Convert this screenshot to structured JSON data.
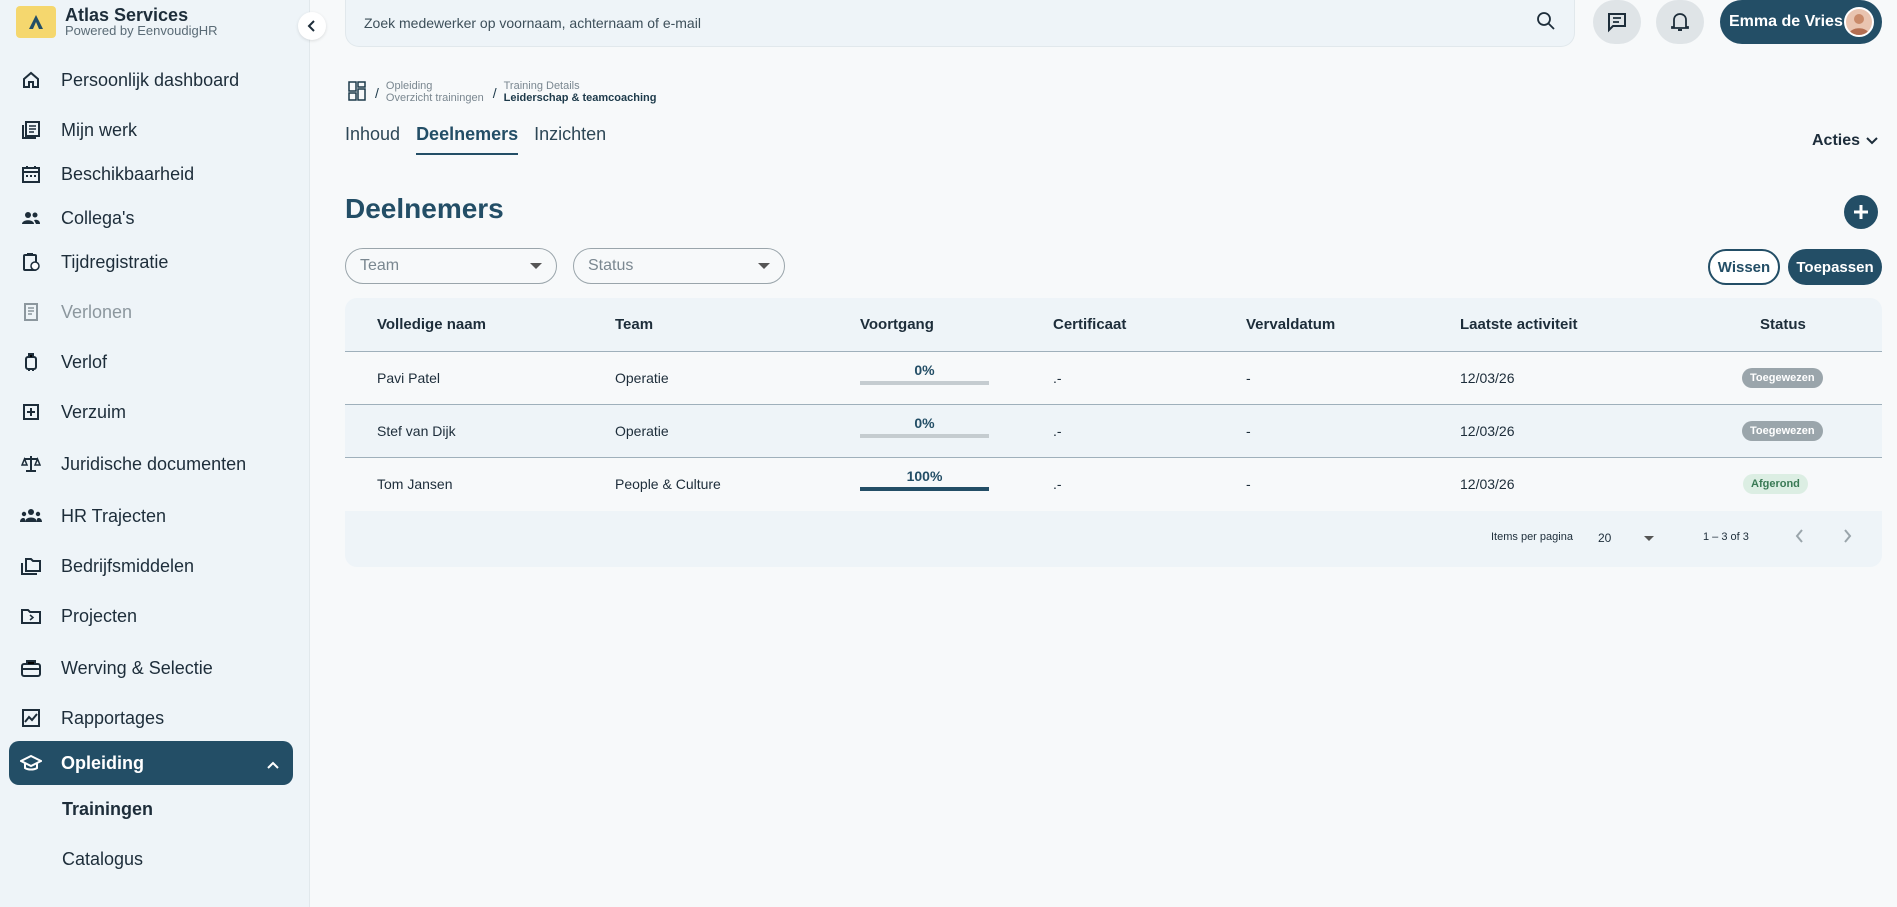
{
  "brand": {
    "title": "Atlas Services",
    "subtitle": "Powered by EenvoudigHR"
  },
  "sidebar": {
    "items": [
      {
        "label": "Persoonlijk dashboard",
        "icon": "home-icon"
      },
      {
        "label": "Mijn werk",
        "icon": "document-list-icon"
      },
      {
        "label": "Beschikbaarheid",
        "icon": "calendar-icon"
      },
      {
        "label": "Collega's",
        "icon": "people-icon"
      },
      {
        "label": "Tijdregistratie",
        "icon": "clipboard-clock-icon"
      },
      {
        "label": "Verlonen",
        "icon": "receipt-icon"
      },
      {
        "label": "Verlof",
        "icon": "suitcase-icon"
      },
      {
        "label": "Verzuim",
        "icon": "medical-icon"
      },
      {
        "label": "Juridische documenten",
        "icon": "scale-icon"
      },
      {
        "label": "HR Trajecten",
        "icon": "group-icon"
      },
      {
        "label": "Bedrijfsmiddelen",
        "icon": "folder-stack-icon"
      },
      {
        "label": "Projecten",
        "icon": "folder-icon"
      },
      {
        "label": "Werving & Selectie",
        "icon": "briefcase-icon"
      },
      {
        "label": "Rapportages",
        "icon": "chart-icon"
      },
      {
        "label": "Opleiding",
        "icon": "graduation-cap-icon"
      }
    ],
    "sub_items": [
      "Trainingen",
      "Catalogus"
    ]
  },
  "search": {
    "placeholder": "Zoek medewerker op voornaam, achternaam of e-mail"
  },
  "user": {
    "name": "Emma de Vries"
  },
  "breadcrumb": [
    {
      "top": "Opleiding",
      "bottom": "Overzicht trainingen"
    },
    {
      "top": "Training Details",
      "bottom": "Leiderschap & teamcoaching"
    }
  ],
  "tabs": [
    "Inhoud",
    "Deelnemers",
    "Inzichten"
  ],
  "actions_label": "Acties",
  "page_title": "Deelnemers",
  "filters": {
    "team_placeholder": "Team",
    "status_placeholder": "Status"
  },
  "buttons": {
    "clear": "Wissen",
    "apply": "Toepassen"
  },
  "table": {
    "headers": [
      "Volledige naam",
      "Team",
      "Voortgang",
      "Certificaat",
      "Vervaldatum",
      "Laatste activiteit",
      "Status"
    ],
    "rows": [
      {
        "name": "Pavi Patel",
        "team": "Operatie",
        "progress": "0%",
        "progress_value": 0,
        "certificate": ".-",
        "expiry": "-",
        "last_activity": "12/03/26",
        "status": "Toegewezen"
      },
      {
        "name": "Stef van Dijk",
        "team": "Operatie",
        "progress": "0%",
        "progress_value": 0,
        "certificate": ".-",
        "expiry": "-",
        "last_activity": "12/03/26",
        "status": "Toegewezen"
      },
      {
        "name": "Tom Jansen",
        "team": "People & Culture",
        "progress": "100%",
        "progress_value": 100,
        "certificate": ".-",
        "expiry": "-",
        "last_activity": "12/03/26",
        "status": "Afgerond"
      }
    ]
  },
  "pagination": {
    "items_per_page_label": "Items per pagina",
    "items_per_page": "20",
    "range": "1 – 3 of 3"
  },
  "colors": {
    "primary": "#234e66",
    "sidebar_bg": "#eef4f8",
    "brand_yellow": "#f5d76e",
    "badge_gray": "#9aa5ab",
    "badge_green_bg": "#dceee3"
  }
}
